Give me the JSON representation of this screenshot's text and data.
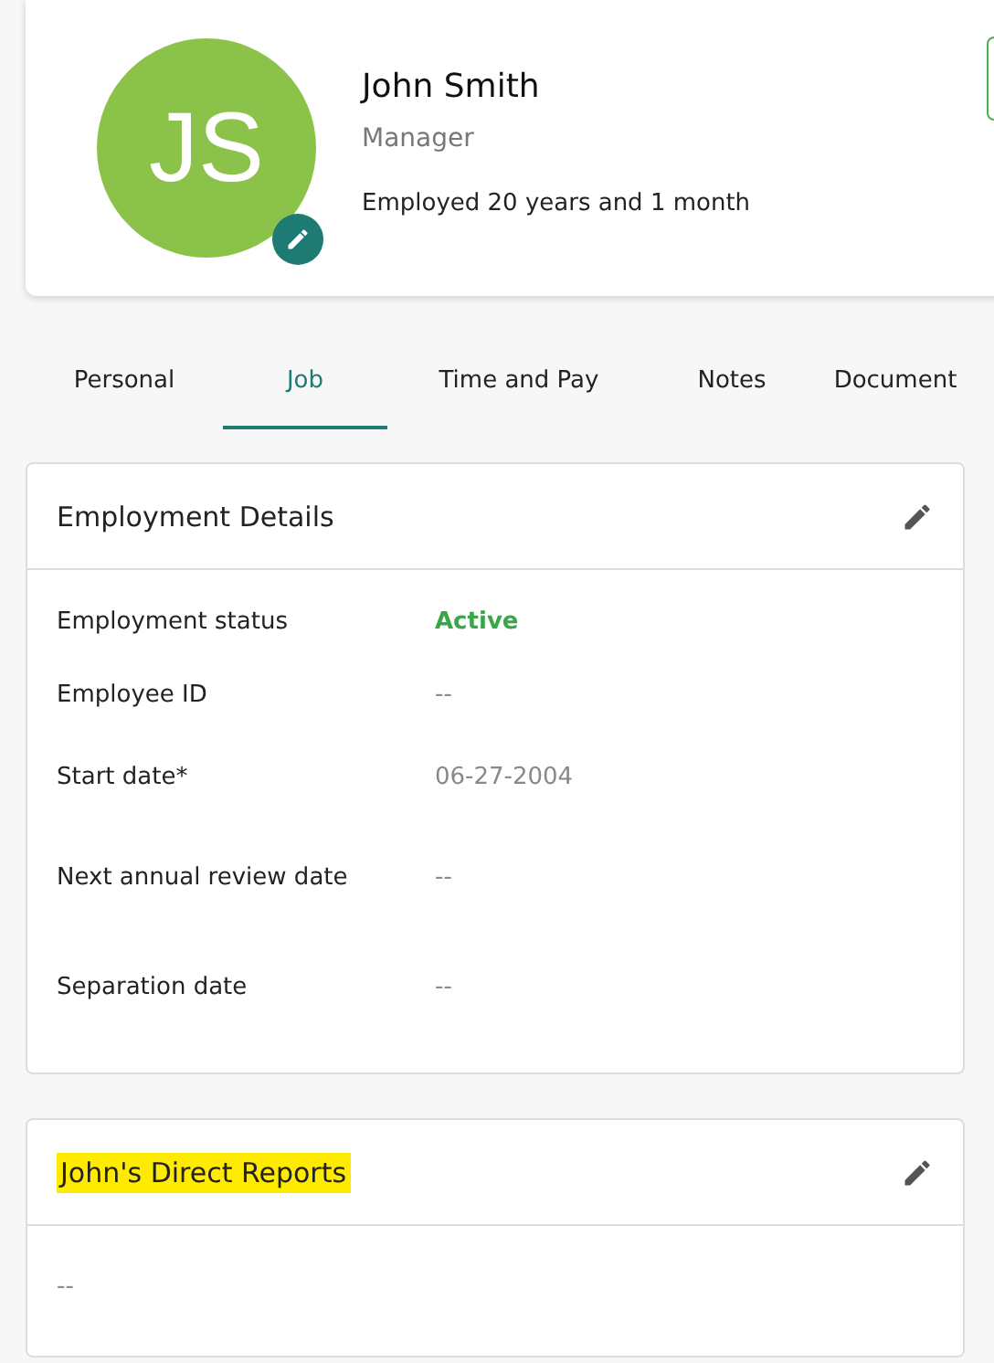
{
  "profile": {
    "initials": "JS",
    "name": "John Smith",
    "title": "Manager",
    "tenure": "Employed 20 years and 1 month"
  },
  "tabs": [
    {
      "label": "Personal",
      "selected": false
    },
    {
      "label": "Job",
      "selected": true
    },
    {
      "label": "Time and Pay",
      "selected": false
    },
    {
      "label": "Notes",
      "selected": false
    },
    {
      "label": "Document",
      "selected": false
    }
  ],
  "employment_details": {
    "title": "Employment Details",
    "rows": [
      {
        "label": "Employment status",
        "value": "Active",
        "kind": "status"
      },
      {
        "label": "Employee ID",
        "value": "--",
        "kind": "plain"
      },
      {
        "label": "Start date*",
        "value": "06-27-2004",
        "kind": "plain"
      },
      {
        "label": "Next annual review date",
        "value": "--",
        "kind": "plain"
      },
      {
        "label": "Separation date",
        "value": "--",
        "kind": "plain"
      }
    ]
  },
  "direct_reports": {
    "title": "John's Direct Reports",
    "highlighted": true,
    "empty_text": "--"
  }
}
